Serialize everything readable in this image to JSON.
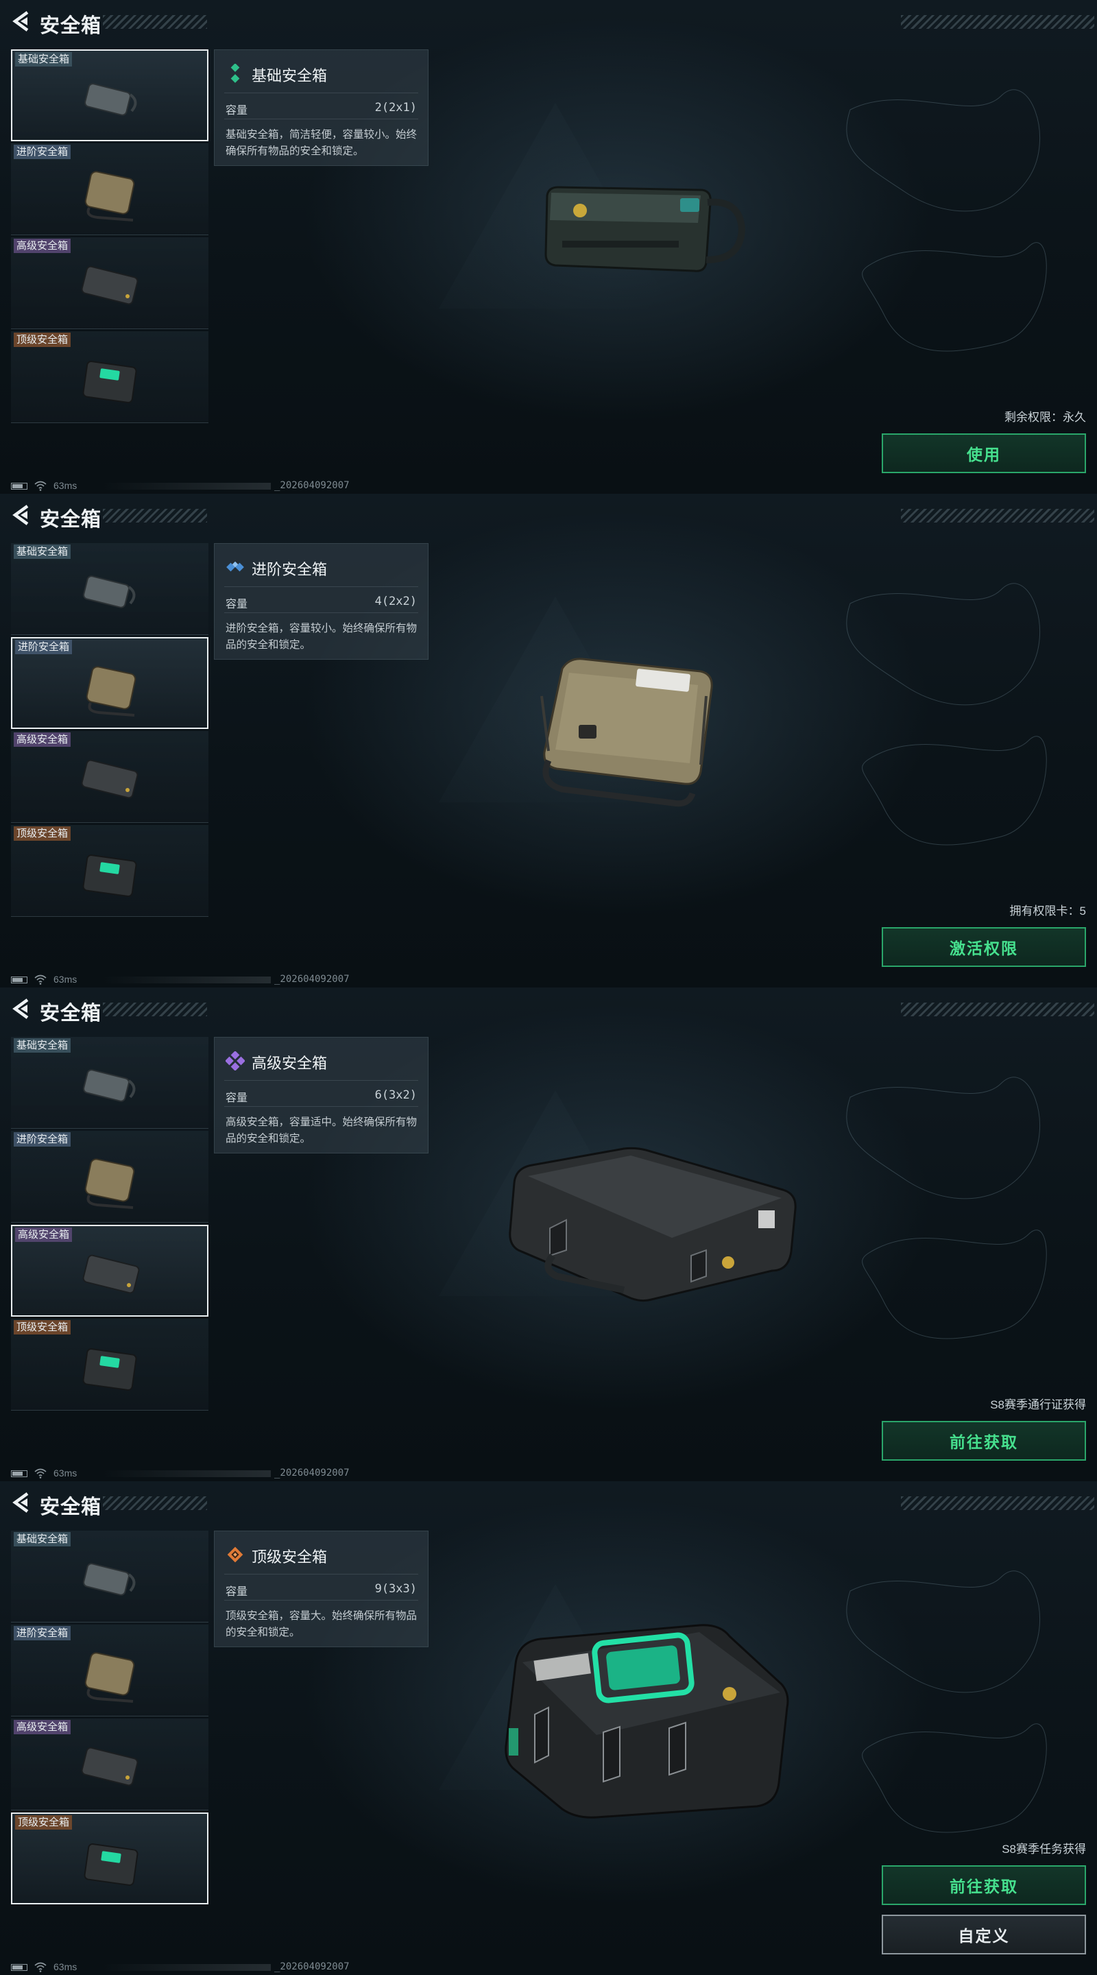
{
  "title": "安全箱",
  "list_items": [
    {
      "label": "基础安全箱",
      "tier": "basic"
    },
    {
      "label": "进阶安全箱",
      "tier": "advanced"
    },
    {
      "label": "高级安全箱",
      "tier": "high"
    },
    {
      "label": "顶级安全箱",
      "tier": "top"
    }
  ],
  "footer": {
    "ping": "63ms",
    "build": "_202604092007"
  },
  "panels": [
    {
      "selected_index": 0,
      "name": "基础安全箱",
      "icon": "diamond-basic-icon",
      "capacity_label": "容量",
      "capacity_value": "2(2x1)",
      "description": "基础安全箱，简洁轻便，容量较小。始终确保所有物品的安全和锁定。",
      "status": "剩余权限：永久",
      "buttons": [
        {
          "label": "使用",
          "style": "green"
        }
      ]
    },
    {
      "selected_index": 1,
      "name": "进阶安全箱",
      "icon": "diamond-advanced-icon",
      "capacity_label": "容量",
      "capacity_value": "4(2x2)",
      "description": "进阶安全箱，容量较小。始终确保所有物品的安全和锁定。",
      "status": "拥有权限卡：5",
      "buttons": [
        {
          "label": "激活权限",
          "style": "green"
        }
      ]
    },
    {
      "selected_index": 2,
      "name": "高级安全箱",
      "icon": "diamond-high-icon",
      "capacity_label": "容量",
      "capacity_value": "6(3x2)",
      "description": "高级安全箱，容量适中。始终确保所有物品的安全和锁定。",
      "status": "S8赛季通行证获得",
      "buttons": [
        {
          "label": "前往获取",
          "style": "green"
        }
      ]
    },
    {
      "selected_index": 3,
      "name": "顶级安全箱",
      "icon": "diamond-top-icon",
      "capacity_label": "容量",
      "capacity_value": "9(3x3)",
      "description": "顶级安全箱，容量大。始终确保所有物品的安全和锁定。",
      "status": "S8赛季任务获得",
      "buttons": [
        {
          "label": "前往获取",
          "style": "green"
        },
        {
          "label": "自定义",
          "style": "grey"
        }
      ]
    }
  ]
}
